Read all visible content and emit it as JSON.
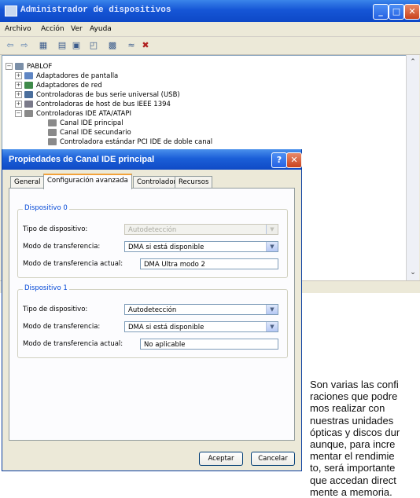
{
  "window": {
    "title": "Administrador de dispositivos",
    "controls": {
      "minimize": "_",
      "maximize": "□",
      "close": "✕"
    }
  },
  "menubar": {
    "items": [
      "Archivo",
      "Acción",
      "Ver",
      "Ayuda"
    ]
  },
  "toolbar": {
    "icons": [
      "back-arrow-icon",
      "forward-arrow-icon",
      "show-hide-icon",
      "properties-icon",
      "print-icon",
      "help-icon",
      "scan-hardware-icon",
      "uninstall-icon",
      "disable-icon"
    ]
  },
  "tree": {
    "root": "PABLOF",
    "items": [
      {
        "label": "Adaptadores de pantalla",
        "expander": "+",
        "icon": "monitor-icon"
      },
      {
        "label": "Adaptadores de red",
        "expander": "+",
        "icon": "network-card-icon"
      },
      {
        "label": "Controladoras de bus serie universal (USB)",
        "expander": "+",
        "icon": "usb-icon"
      },
      {
        "label": "Controladoras de host de bus IEEE 1394",
        "expander": "+",
        "icon": "firewire-icon"
      },
      {
        "label": "Controladoras IDE ATA/ATAPI",
        "expander": "−",
        "icon": "ide-controller-icon"
      }
    ],
    "children": [
      "Canal IDE principal",
      "Canal IDE secundario",
      "Controladora estándar PCI IDE de doble canal"
    ]
  },
  "dialog": {
    "title": "Propiedades de Canal IDE principal",
    "help_button": "?",
    "close_button": "✕",
    "tabs": [
      "General",
      "Configuración avanzada",
      "Controlador",
      "Recursos"
    ],
    "active_tab": "Configuración avanzada",
    "device0": {
      "legend": "Dispositivo 0",
      "type_label": "Tipo de dispositivo:",
      "type_value": "Autodetección",
      "mode_label": "Modo de transferencia:",
      "mode_value": "DMA si está disponible",
      "current_label": "Modo de transferencia actual:",
      "current_value": "DMA Ultra modo 2"
    },
    "device1": {
      "legend": "Dispositivo 1",
      "type_label": "Tipo de dispositivo:",
      "type_value": "Autodetección",
      "mode_label": "Modo de transferencia:",
      "mode_value": "DMA si está disponible",
      "current_label": "Modo de transferencia actual:",
      "current_value": "No aplicable"
    },
    "ok": "Aceptar",
    "cancel": "Cancelar"
  },
  "article": {
    "lines": [
      "Son varias las confi",
      "raciones que podre",
      "mos realizar con",
      "nuestras unidades",
      "ópticas y discos dur",
      "aunque, para incre",
      "mentar el rendimie",
      "to, será importante",
      "que accedan direct",
      "mente a memoria."
    ]
  },
  "colors": {
    "title_bar": "#1656d6",
    "tab_highlight": "#f2a23a",
    "group_legend": "#0046d5",
    "close_button": "#c9421d"
  }
}
